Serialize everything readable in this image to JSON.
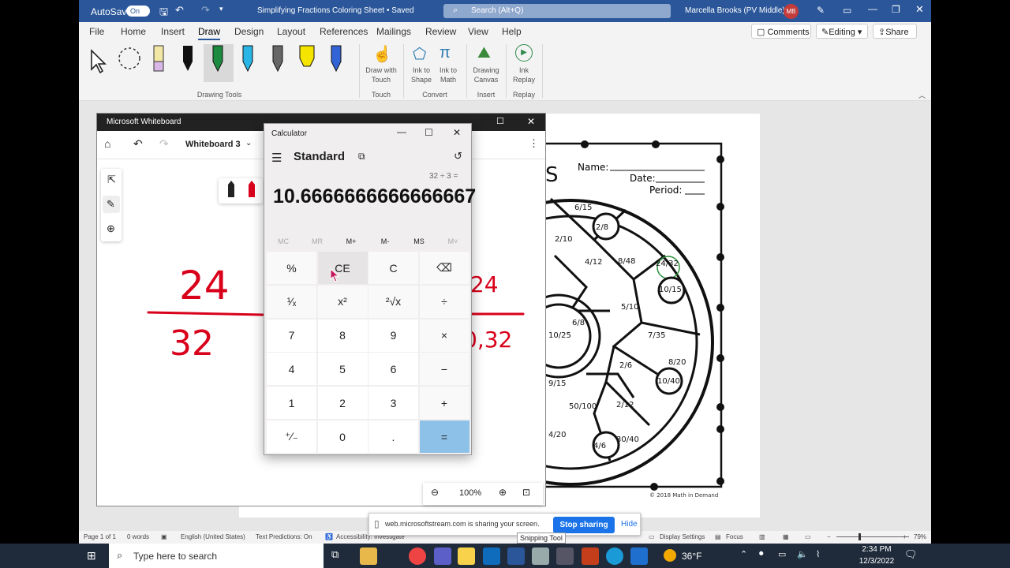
{
  "word": {
    "autosave": "AutoSave",
    "autosave_state": "On",
    "doc_title": "Simplifying Fractions Coloring Sheet • Saved",
    "search_placeholder": "Search (Alt+Q)",
    "user": "Marcella Brooks (PV Middle)",
    "initials": "MB",
    "menu": [
      "File",
      "Home",
      "Insert",
      "Draw",
      "Design",
      "Layout",
      "References",
      "Mailings",
      "Review",
      "View",
      "Help"
    ],
    "comments": "Comments",
    "editing": "Editing",
    "share": "Share",
    "ribbon": {
      "drawing_tools": "Drawing Tools",
      "draw_with": "Draw with",
      "touch": "Touch",
      "touch_group": "Touch",
      "ink_to": "Ink to",
      "shape": "Shape",
      "math": "Math",
      "convert": "Convert",
      "drawing": "Drawing",
      "canvas": "Canvas",
      "insert": "Insert",
      "ink": "Ink",
      "replay": "Replay",
      "replay_group": "Replay"
    },
    "status": {
      "page": "Page 1 of 1",
      "words": "0 words",
      "language": "English (United States)",
      "predictions": "Text Predictions: On",
      "accessibility": "Accessibility: Investigate",
      "display": "Display Settings",
      "focus": "Focus",
      "zoom": "79%"
    }
  },
  "worksheet": {
    "title_letter": "S",
    "name": "Name:",
    "date": "Date:",
    "period": "Period:",
    "copyright": "© 2018 Math in Demand",
    "fractions": [
      [
        "6",
        "15"
      ],
      [
        "2",
        "8"
      ],
      [
        "2",
        "10"
      ],
      [
        "4",
        "12"
      ],
      [
        "8",
        "48"
      ],
      [
        "24",
        "32"
      ],
      [
        "10",
        "15"
      ],
      [
        "5",
        "10"
      ],
      [
        "10",
        "25"
      ],
      [
        "6",
        "8"
      ],
      [
        "7",
        "35"
      ],
      [
        "2",
        "6"
      ],
      [
        "8",
        "20"
      ],
      [
        "10",
        "40"
      ],
      [
        "9",
        "15"
      ],
      [
        "50",
        "100"
      ],
      [
        "2",
        "12"
      ],
      [
        "4",
        "20"
      ],
      [
        "4",
        "6"
      ],
      [
        "30",
        "40"
      ]
    ]
  },
  "whiteboard": {
    "title": "Microsoft Whiteboard",
    "board": "Whiteboard 3",
    "zoom": "100%",
    "ink": {
      "top": "24",
      "bottom": "32",
      "right_top": ",24",
      "right_bottom": "0,32"
    }
  },
  "calculator": {
    "title": "Calculator",
    "mode": "Standard",
    "expression": "32 ÷ 3 =",
    "display": "10.6666666666666667",
    "memory": [
      "MC",
      "MR",
      "M+",
      "M-",
      "MS",
      "M˅"
    ],
    "keys": [
      "%",
      "CE",
      "C",
      "⌫",
      "¹⁄ₓ",
      "x²",
      "²√x",
      "÷",
      "7",
      "8",
      "9",
      "×",
      "4",
      "5",
      "6",
      "−",
      "1",
      "2",
      "3",
      "+",
      "⁺⁄₋",
      "0",
      ".",
      "="
    ]
  },
  "share_bar": {
    "message": "web.microsoftstream.com is sharing your screen.",
    "stop": "Stop sharing",
    "hide": "Hide",
    "tooltip": "Snipping Tool"
  },
  "taskbar": {
    "search_placeholder": "Type here to search",
    "weather": "36°F",
    "time": "2:34 PM",
    "date": "12/3/2022"
  },
  "colors": {
    "word_blue": "#2b579a",
    "accent": "#1a73e8",
    "ink_red": "#d9001b"
  }
}
